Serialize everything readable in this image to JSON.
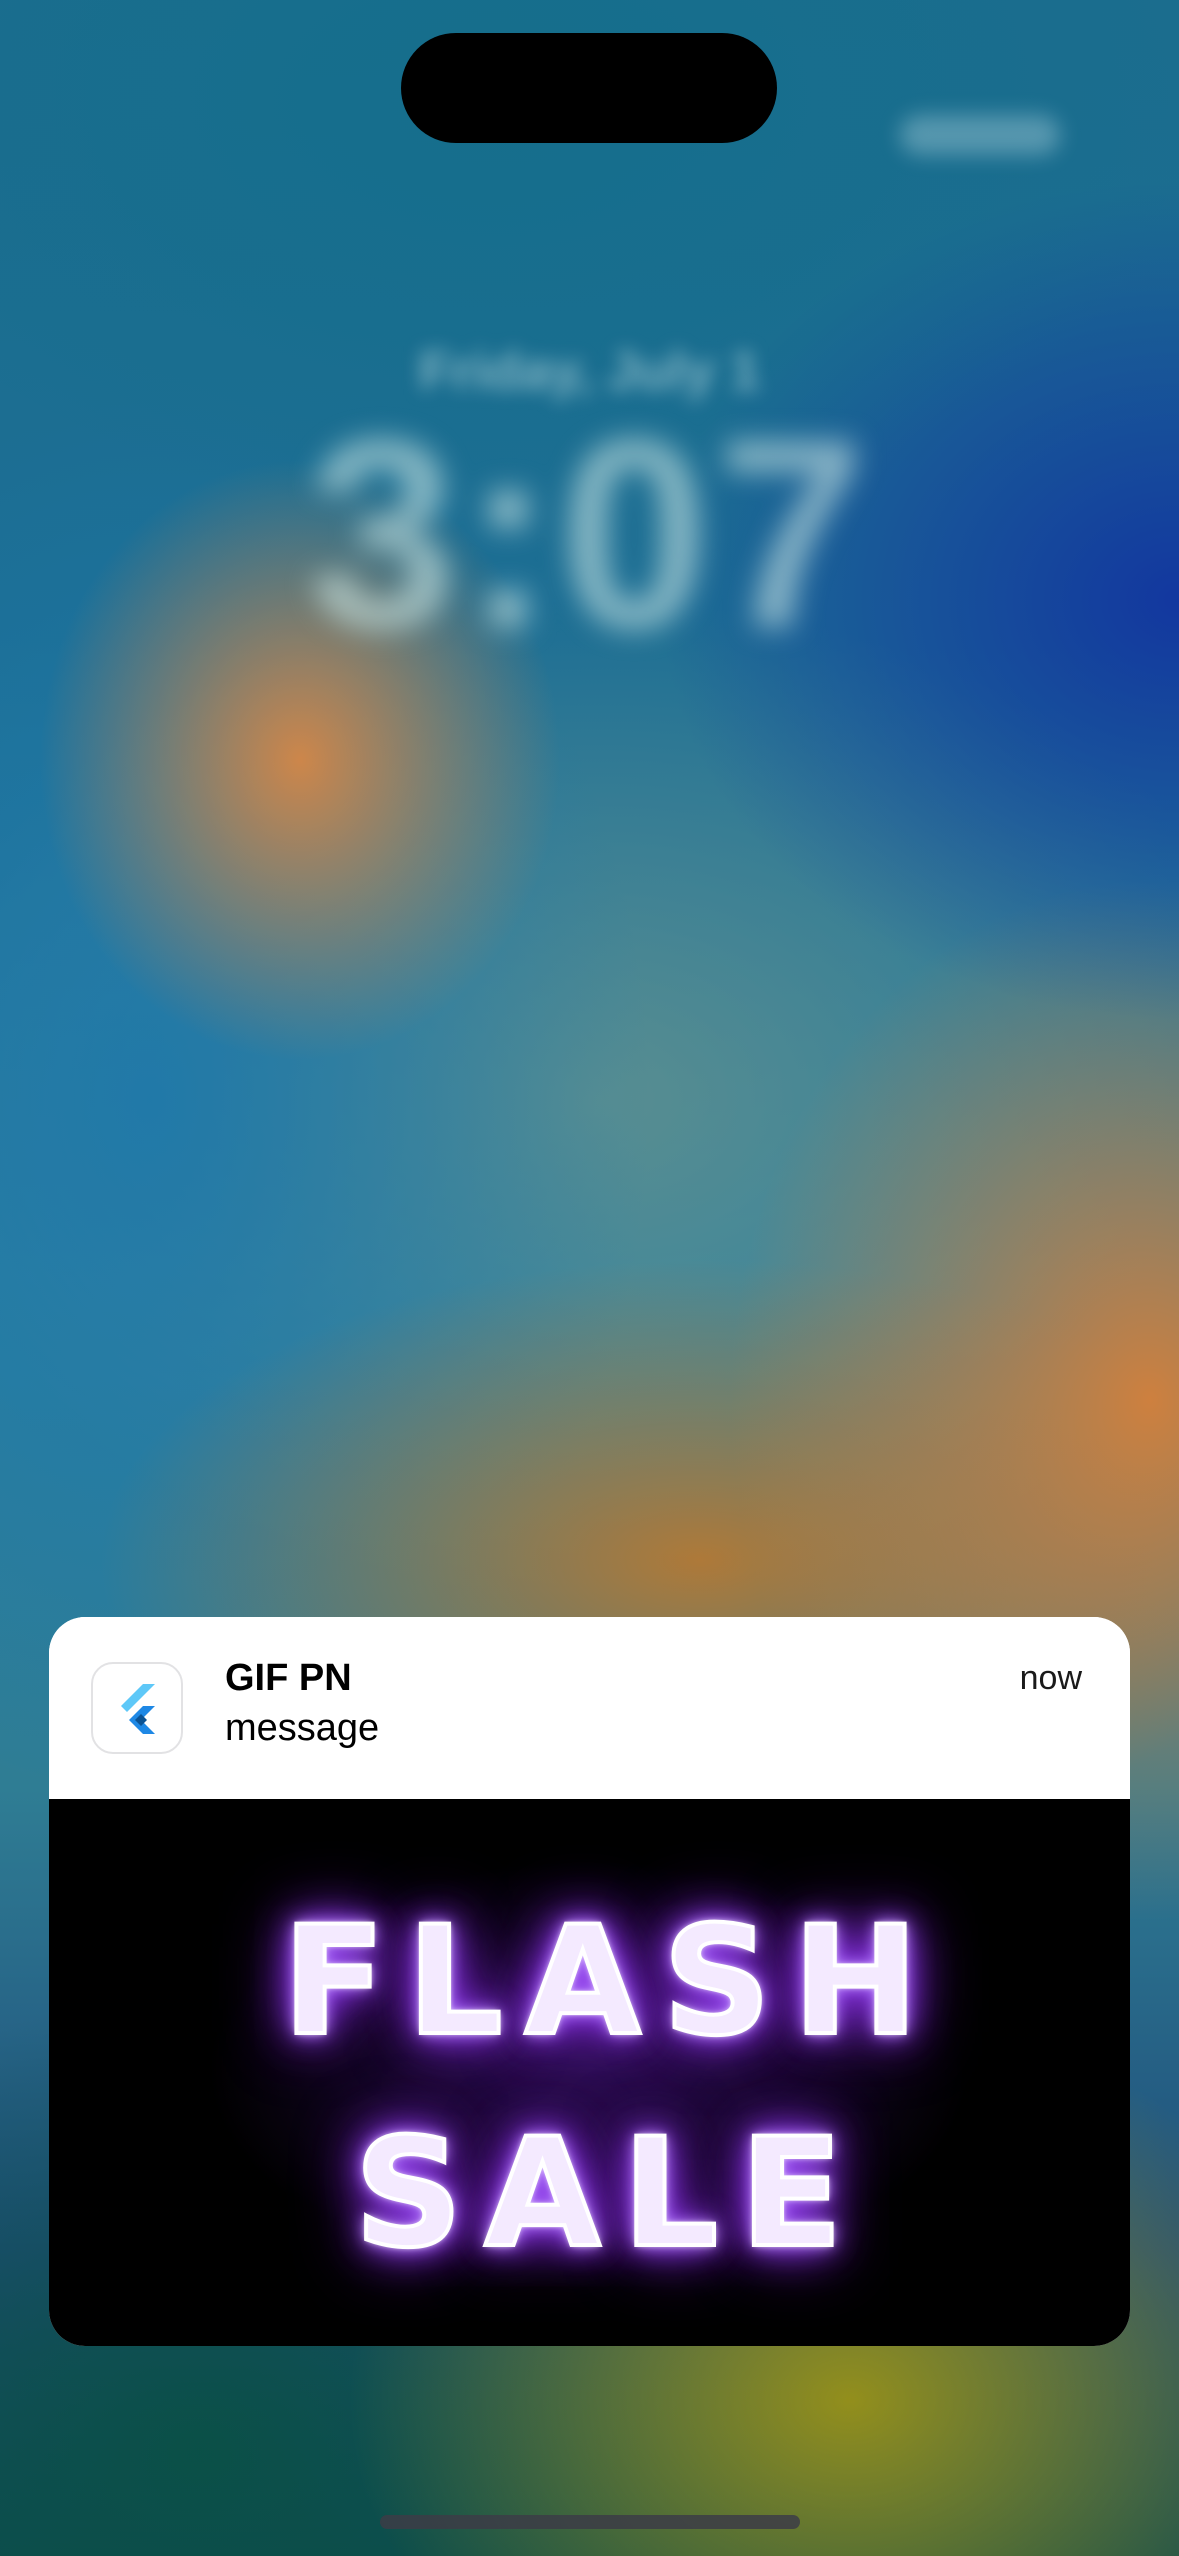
{
  "lockscreen": {
    "date_text": "Friday, July 1",
    "time_text": "3:07"
  },
  "notification": {
    "app_name": "GIF PN",
    "message": "message",
    "timestamp": "now",
    "app_icon": "flutter-logo-icon",
    "media": {
      "line1": "FLASH",
      "line2": "SALE"
    }
  },
  "colors": {
    "neon_purple": "#9b4dff",
    "notification_bg": "#ffffff",
    "flutter_light_blue": "#5ec8f8",
    "flutter_dark_blue": "#0b5394"
  }
}
